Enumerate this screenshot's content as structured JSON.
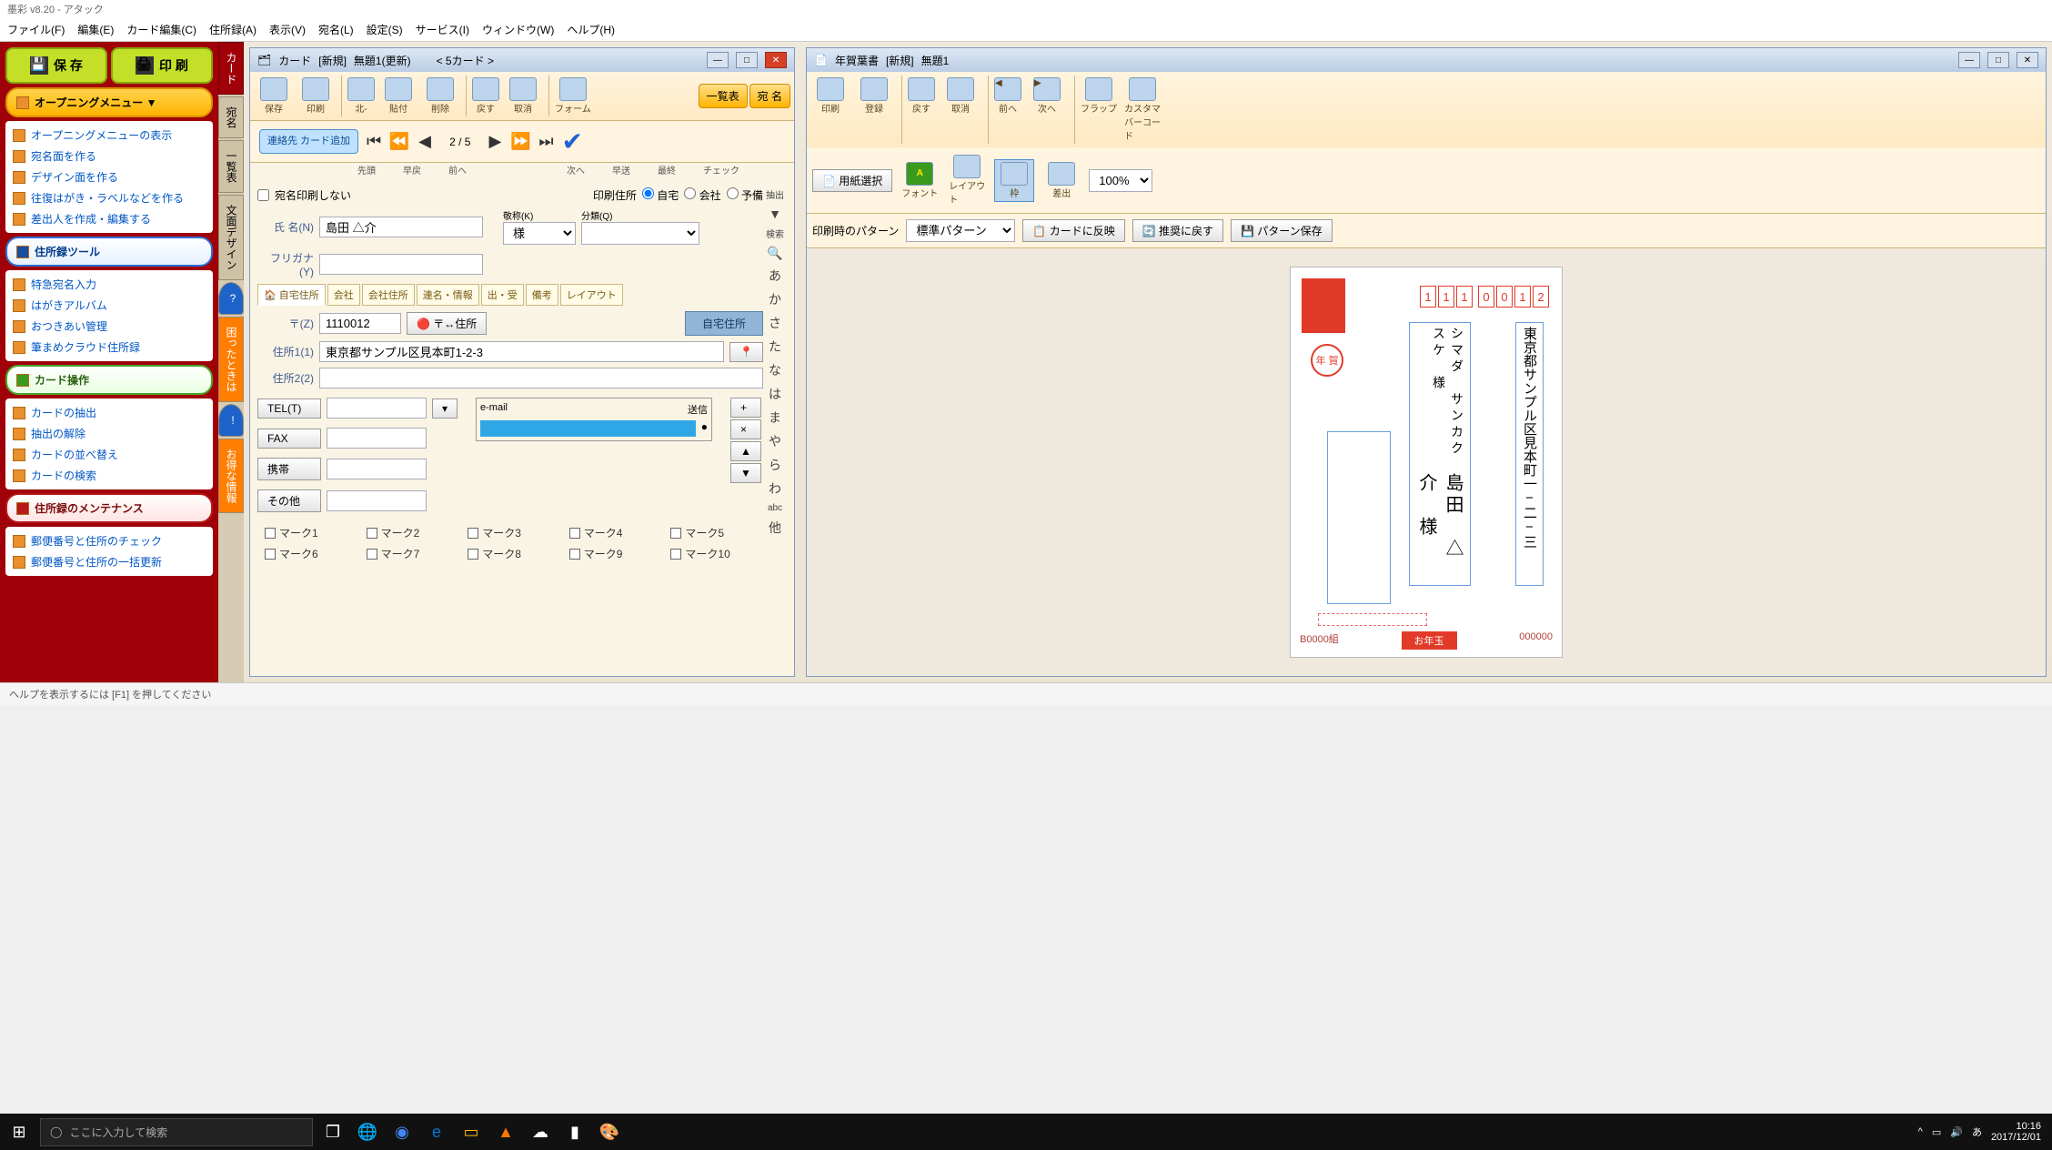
{
  "app_title": "墨彩 v8.20 - アタック",
  "menubar": [
    "ファイル(F)",
    "編集(E)",
    "カード編集(C)",
    "住所録(A)",
    "表示(V)",
    "宛名(L)",
    "設定(S)",
    "サービス(I)",
    "ウィンドウ(W)",
    "ヘルプ(H)"
  ],
  "sidebar": {
    "save": "保 存",
    "print": "印 刷",
    "opening_hdr": "オープニングメニュー ▼",
    "opening_items": [
      "オープニングメニューの表示",
      "宛名面を作る",
      "デザイン面を作る",
      "往復はがき・ラベルなどを作る",
      "差出人を作成・編集する"
    ],
    "tool_hdr": "住所録ツール",
    "tool_items": [
      "特急宛名入力",
      "はがきアルバム",
      "おつきあい管理",
      "筆まめクラウド住所録"
    ],
    "card_hdr": "カード操作",
    "card_items": [
      "カードの抽出",
      "抽出の解除",
      "カードの並べ替え",
      "カードの検索"
    ],
    "maint_hdr": "住所録のメンテナンス",
    "maint_items": [
      "郵便番号と住所のチェック",
      "郵便番号と住所の一括更新"
    ]
  },
  "vtabs": {
    "card": "カード",
    "atena": "宛名",
    "list": "一覧表",
    "design": "文面デザイン",
    "help": "困ったときは",
    "info": "お得な情報"
  },
  "card_window": {
    "title_prefix": "カード",
    "title_mode": "[新規]",
    "title_doc": "無題1(更新)",
    "title_count": "< 5カード >",
    "tools": [
      "保存",
      "印刷",
      "北-",
      "貼付",
      "削除",
      "戻す",
      "取消",
      "フォーム"
    ],
    "btn_list": "一覧表",
    "btn_name": "宛 名",
    "add_card": "連絡先\nカード追加",
    "nav_labels": [
      "先頭",
      "早戻",
      "前へ",
      "次へ",
      "早送",
      "最終",
      "チェック"
    ],
    "page_pos": "2 /",
    "page_total": "5",
    "no_print": "宛名印刷しない",
    "print_addr_label": "印刷住所",
    "print_addr_opts": [
      "自宅",
      "会社",
      "予備"
    ],
    "field_name": "氏 名(N)",
    "name_value": "島田 △介",
    "field_keisho": "敬称(K)",
    "keisho_value": "様",
    "field_bunrui": "分類(Q)",
    "field_furigana": "フリガナ(Y)",
    "subtabs": [
      "自宅住所",
      "会社",
      "会社住所",
      "連名・情報",
      "出・受",
      "備考",
      "レイアウト"
    ],
    "field_zip": "〒(Z)",
    "zip_value": "1110012",
    "btn_zip_addr": "〒↔住所",
    "btn_home_addr": "自宅住所",
    "field_addr1": "住所1(1)",
    "addr1_value": "東京都サンプル区見本町1-2-3",
    "field_addr2": "住所2(2)",
    "btn_tel": "TEL(T)",
    "btn_fax": "FAX",
    "btn_mobile": "携帯",
    "btn_other": "その他",
    "email_hdr": "e-mail",
    "email_send": "送信",
    "kana_col": [
      "抽出",
      "▼",
      "検索",
      "🔍",
      "あ",
      "か",
      "さ",
      "た",
      "な",
      "は",
      "ま",
      "や",
      "ら",
      "わ",
      "abc",
      "他"
    ],
    "marks": [
      "マーク1",
      "マーク2",
      "マーク3",
      "マーク4",
      "マーク5",
      "マーク6",
      "マーク7",
      "マーク8",
      "マーク9",
      "マーク10"
    ]
  },
  "preview_window": {
    "title_prefix": "年賀葉書",
    "title_mode": "[新規]",
    "title_doc": "無題1",
    "tools": [
      "印刷",
      "登録",
      "戻す",
      "取消",
      "前へ",
      "次へ",
      "フラップ",
      "カスタマバーコード"
    ],
    "btn_paper": "用紙選択",
    "tools2": [
      "フォント",
      "レイアウト",
      "枠",
      "差出"
    ],
    "zoom": "100%",
    "pattern_label": "印刷時のパターン",
    "pattern_value": "標準パターン",
    "btn_reflect": "カードに反映",
    "btn_reset": "推奨に戻す",
    "btn_pattern_save": "パターン保存",
    "postcard": {
      "zip": [
        "1",
        "1",
        "1",
        "0",
        "0",
        "1",
        "2"
      ],
      "nenga": "年 賀",
      "address": "東京都サンプル区見本町一−二−三",
      "name1": "島田　△介　様",
      "name2": "シマダ　サンカクスケ　様",
      "lottery_left": "B0000組",
      "lottery_mid": "お年玉",
      "lottery_right": "000000"
    }
  },
  "statusbar": "ヘルプを表示するには [F1] を押してください",
  "taskbar": {
    "search_placeholder": "ここに入力して検索",
    "time": "10:16",
    "date": "2017/12/01",
    "ime": "あ"
  }
}
